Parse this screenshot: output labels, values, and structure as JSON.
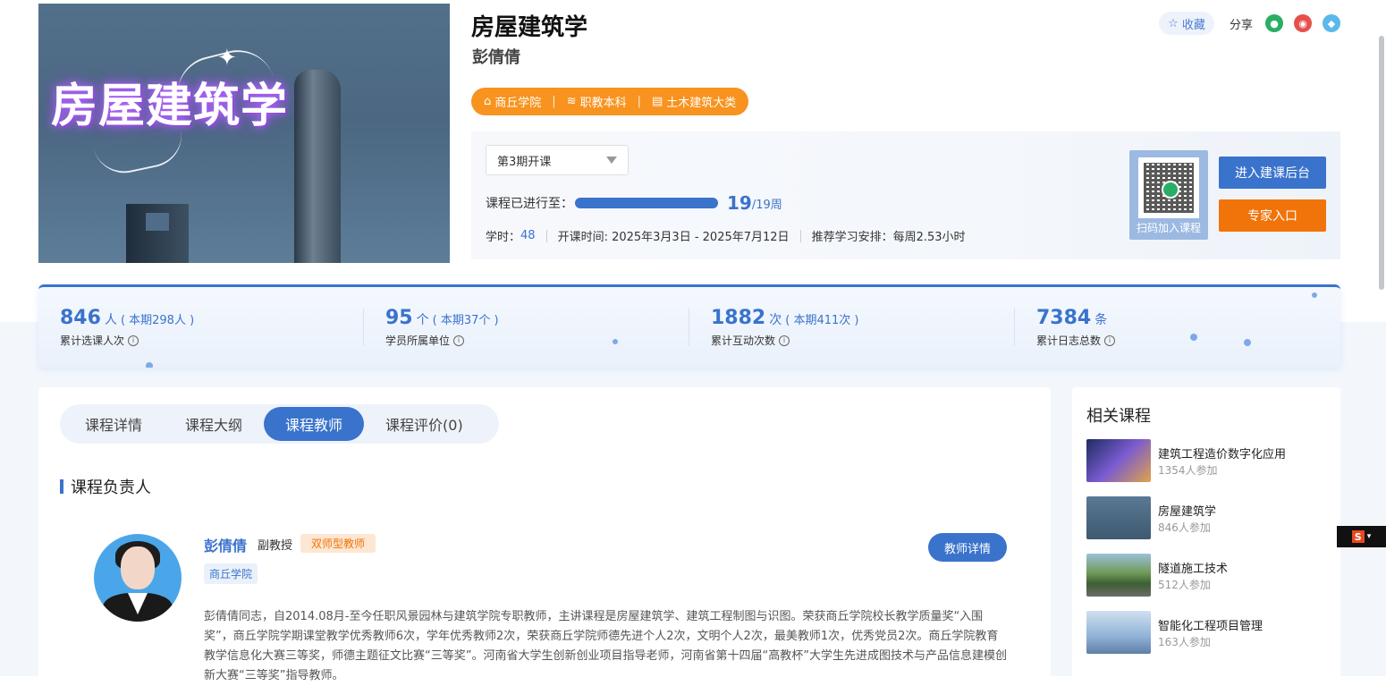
{
  "course": {
    "title": "房屋建筑学",
    "hero_title": "房屋建筑学",
    "teacher": "彭倩倩",
    "tags": [
      "商丘学院",
      "职教本科",
      "土木建筑大类"
    ]
  },
  "actions": {
    "favorite_label": "收藏",
    "share_label": "分享",
    "share_targets": [
      "wechat-icon",
      "weibo-icon",
      "qq-icon"
    ]
  },
  "session": {
    "selected": "第3期开课",
    "progress_label": "课程已进行至：",
    "progress_current": "19",
    "progress_total": "/19周",
    "progress_fraction": 1.0,
    "hours_label": "学时：",
    "hours_value": "48",
    "date_range": "开课时间: 2025年3月3日 - 2025年7月12日",
    "recommend": "推荐学习安排：每周2.53小时"
  },
  "qr": {
    "label": "扫码加入课程"
  },
  "buttons": {
    "backend": "进入建课后台",
    "expert": "专家入口",
    "teacher_detail": "教师详情"
  },
  "stats": [
    {
      "num": "846",
      "unit": "人",
      "sub": "( 本期298人 )",
      "label": "累计选课人次"
    },
    {
      "num": "95",
      "unit": "个",
      "sub": "( 本期37个 )",
      "label": "学员所属单位"
    },
    {
      "num": "1882",
      "unit": "次",
      "sub": "( 本期411次 )",
      "label": "累计互动次数"
    },
    {
      "num": "7384",
      "unit": "条",
      "sub": "",
      "label": "累计日志总数"
    }
  ],
  "tabs": [
    "课程详情",
    "课程大纲",
    "课程教师",
    "课程评价(0)"
  ],
  "section": {
    "title": "课程负责人"
  },
  "teacher": {
    "name": "彭倩倩",
    "rank": "副教授",
    "badge": "双师型教师",
    "school": "商丘学院",
    "bio": "彭倩倩同志，自2014.08月-至今任职风景园林与建筑学院专职教师，主讲课程是房屋建筑学、建筑工程制图与识图。荣获商丘学院校长教学质量奖“入围奖”，商丘学院学期课堂教学优秀教师6次，学年优秀教师2次，荣获商丘学院师德先进个人2次，文明个人2次，最美教师1次，优秀党员2次。商丘学院教育教学信息化大赛三等奖，师德主题征文比赛“三等奖”。河南省大学生创新创业项目指导老师，河南省第十四届“高教杯”大学生先进成图技术与产品信息建模创新大赛“三等奖”指导教师。"
  },
  "related": {
    "title": "相关课程",
    "items": [
      {
        "name": "建筑工程造价数字化应用",
        "count": "1354人参加"
      },
      {
        "name": "房屋建筑学",
        "count": "846人参加"
      },
      {
        "name": "隧道施工技术",
        "count": "512人参加"
      },
      {
        "name": "智能化工程项目管理",
        "count": "163人参加"
      }
    ]
  },
  "colors": {
    "primary": "#3a73cc",
    "orange": "#f07409",
    "tag_orange": "#f7931e"
  }
}
